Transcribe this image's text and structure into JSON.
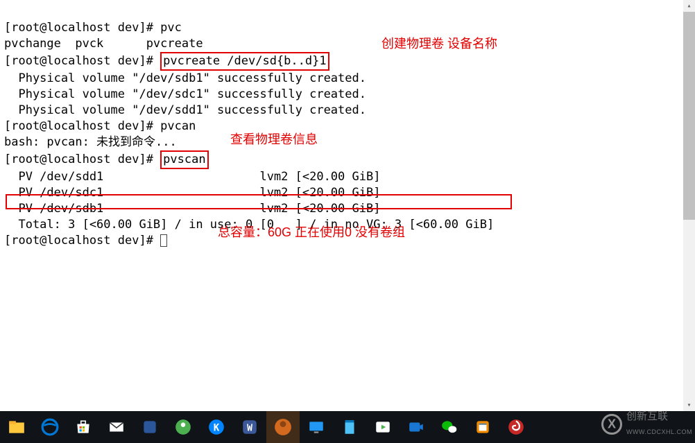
{
  "lines": {
    "l1": "[root@localhost dev]# pvc",
    "l2": "pvchange  pvck      pvcreate",
    "l3_prompt": "[root@localhost dev]# ",
    "l3_cmd": "pvcreate /dev/sd{b..d}1",
    "l4": "  Physical volume \"/dev/sdb1\" successfully created.",
    "l5": "  Physical volume \"/dev/sdc1\" successfully created.",
    "l6": "  Physical volume \"/dev/sdd1\" successfully created.",
    "l7": "[root@localhost dev]# pvcan",
    "l8": "bash: pvcan: 未找到命令...",
    "l9_prompt": "[root@localhost dev]# ",
    "l9_cmd": "pvscan",
    "l10": "  PV /dev/sdd1                      lvm2 [<20.00 GiB]",
    "l11": "  PV /dev/sdc1                      lvm2 [<20.00 GiB]",
    "l12": "  PV /dev/sdb1                      lvm2 [<20.00 GiB]",
    "l13": "  Total: 3 [<60.00 GiB] / in use: 0 [0   ] / in no VG: 3 [<60.00 GiB]",
    "l14": "[root@localhost dev]# "
  },
  "annotations": {
    "a1": "创建物理卷  设备名称",
    "a2": "查看物理卷信息",
    "a3": "总容量：60G   正在使用0     没有卷组"
  },
  "watermark": {
    "text1": "创新互联",
    "text2": "WWW.CDCXHL.COM"
  }
}
